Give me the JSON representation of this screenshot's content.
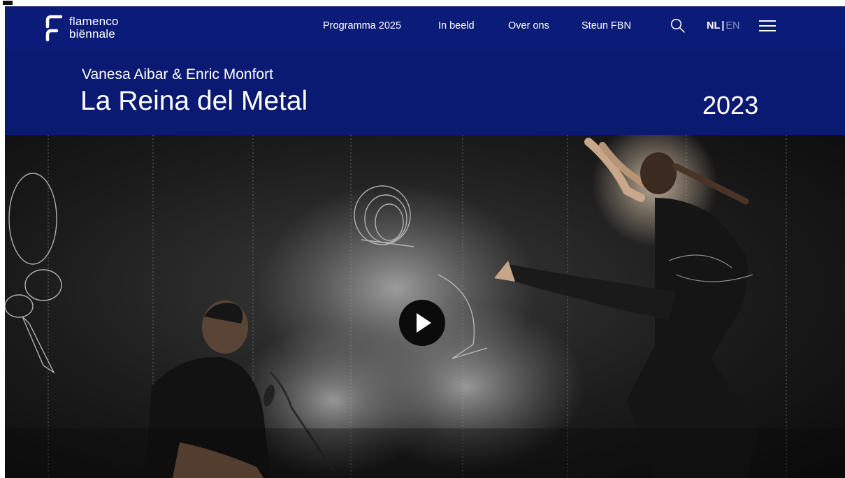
{
  "logo": {
    "line1": "flamenco",
    "line2": "biënnale"
  },
  "nav": {
    "items": [
      "Programma 2025",
      "In beeld",
      "Over ons",
      "Steun FBN"
    ],
    "search_icon": "search-icon",
    "menu_icon": "hamburger-menu-icon"
  },
  "language": {
    "active": "NL",
    "separator": "|",
    "inactive": "EN"
  },
  "event": {
    "artists": "Vanesa Aibar & Enric Monfort",
    "title": "La Reina del Metal",
    "year": "2023"
  },
  "hero": {
    "image": "performance-photo",
    "play_icon": "play-icon"
  },
  "colors": {
    "brand_navy": "#0a1a72",
    "nav_navy": "#0b1c78",
    "inactive_language": "#8d96c9",
    "play_button": "#0b0b0b"
  }
}
